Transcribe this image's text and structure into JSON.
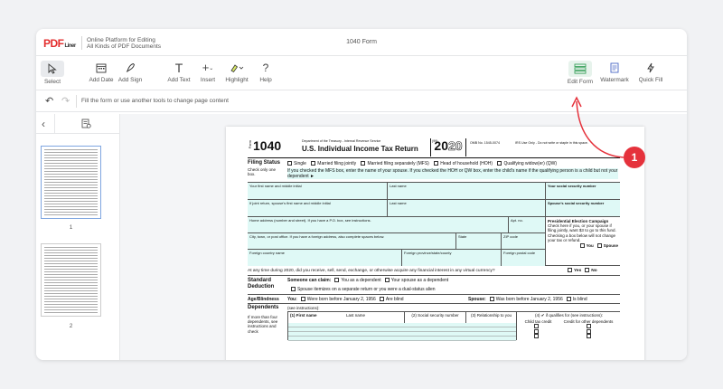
{
  "app": {
    "logo": "PDF",
    "logo_suffix": "Liner",
    "tagline_line1": "Online Platform for Editing",
    "tagline_line2": "All Kinds of PDF Documents",
    "document_title": "1040 Form"
  },
  "toolbar": {
    "select": "Select",
    "add_date": "Add Date",
    "add_sign": "Add Sign",
    "add_text": "Add Text",
    "insert": "Insert",
    "highlight": "Highlight",
    "help": "Help",
    "edit_form": "Edit Form",
    "watermark": "Watermark",
    "quick_fill": "Quick Fill"
  },
  "hint": "Fill the form or use another tools to change page content",
  "thumbnails": [
    {
      "page": "1",
      "selected": true
    },
    {
      "page": "2",
      "selected": false
    }
  ],
  "callout_number": "1",
  "colors": {
    "accent_red": "#e5323c",
    "form_cyan": "#dff9f6",
    "edit_green": "#3aa15c"
  },
  "form": {
    "form_label": "Form",
    "number": "1040",
    "dept": "Department of the Treasury - Internal Revenue Service",
    "code": "(99)",
    "title": "U.S. Individual Income Tax Return",
    "year_solid": "20",
    "year_outline": "20",
    "omb": "OMB No. 1545-0074",
    "irs_only": "IRS Use Only - Do not write or staple in this space.",
    "filing_status": "Filing Status",
    "check_only": "Check only one box.",
    "fs_options": [
      "Single",
      "Married filing jointly",
      "Married filing separately (MFS)",
      "Head of household (HOH)",
      "Qualifying widow(er) (QW)"
    ],
    "fs_note": "If you checked the MFS box, enter the name of your spouse. If you checked the HOH or QW box, enter the child's name if the qualifying person is a child but not your dependent ►",
    "first_name": "Your first name and middle initial",
    "last_name": "Last name",
    "ssn": "Your social security number",
    "spouse_first": "If joint return, spouse's first name and middle initial",
    "spouse_last": "Last name",
    "spouse_ssn": "Spouse's social security number",
    "home_address": "Home address (number and street). If you have a P.O. box, see instructions.",
    "apt": "Apt. no.",
    "pec_title": "Presidential Election Campaign",
    "pec_text": "Check here if you, or your spouse if filing jointly, want $3 to go to this fund. Checking a box below will not change your tax or refund.",
    "pec_you": "You",
    "pec_spouse": "Spouse",
    "city": "City, town, or post office. If you have a foreign address, also complete spaces below.",
    "state": "State",
    "zip": "ZIP code",
    "foreign_country": "Foreign country name",
    "foreign_province": "Foreign province/state/county",
    "foreign_postal": "Foreign postal code",
    "virtual_q": "At any time during 2020, did you receive, sell, send, exchange, or otherwise acquire any financial interest in any virtual currency?",
    "yes": "Yes",
    "no": "No",
    "std_deduction": "Standard Deduction",
    "someone_claim": "Someone can claim:",
    "as_dependent": "You as a dependent",
    "spouse_dependent": "Your spouse as a dependent",
    "spouse_itemizes": "Spouse itemizes on a separate return or you were a dual-status alien",
    "age_blind": "Age/Blindness",
    "you_label": "You:",
    "born_before": "Were born before January 2, 1956",
    "are_blind": "Are blind",
    "spouse_label": "Spouse:",
    "spouse_born": "Was born before January 2, 1956",
    "is_blind": "Is blind",
    "dependents": "Dependents",
    "see_instructions": "(see instructions):",
    "col1_first": "(1) First name",
    "col1_last": "Last name",
    "col2": "(2) Social security number",
    "col3": "(3) Relationship to you",
    "col4": "(4) ✔ if qualifies for (see instructions):",
    "child_credit": "Child tax credit",
    "other_credit": "Credit for other dependents",
    "more_than_four": "If more than four dependents, see instructions and check"
  }
}
